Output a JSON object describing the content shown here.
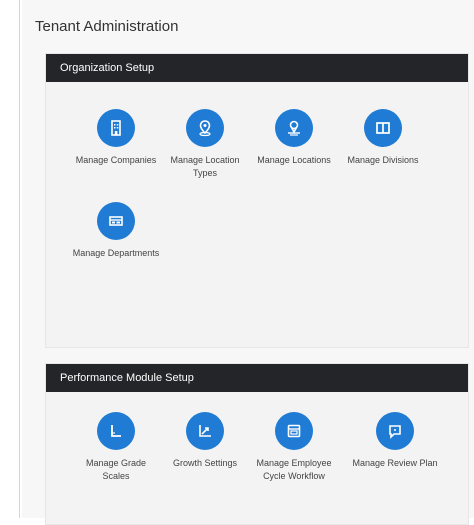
{
  "page": {
    "title": "Tenant Administration"
  },
  "sections": [
    {
      "title": "Organization Setup",
      "tiles": [
        {
          "label": "Manage Companies",
          "icon": "building-icon"
        },
        {
          "label": "Manage Location Types",
          "icon": "location-pin-icon"
        },
        {
          "label": "Manage Locations",
          "icon": "map-pin-icon"
        },
        {
          "label": "Manage Divisions",
          "icon": "columns-icon"
        },
        {
          "label": "Manage Departments",
          "icon": "department-card-icon"
        }
      ]
    },
    {
      "title": "Performance Module Setup",
      "tiles": [
        {
          "label": "Manage Grade Scales",
          "icon": "grade-scale-icon"
        },
        {
          "label": "Growth Settings",
          "icon": "growth-chart-icon"
        },
        {
          "label": "Manage Employee Cycle Workflow",
          "icon": "workflow-icon"
        },
        {
          "label": "Manage Review Plan",
          "icon": "review-chat-icon"
        }
      ]
    }
  ],
  "colors": {
    "accent": "#1f7bd3",
    "header_bg": "#232528"
  }
}
